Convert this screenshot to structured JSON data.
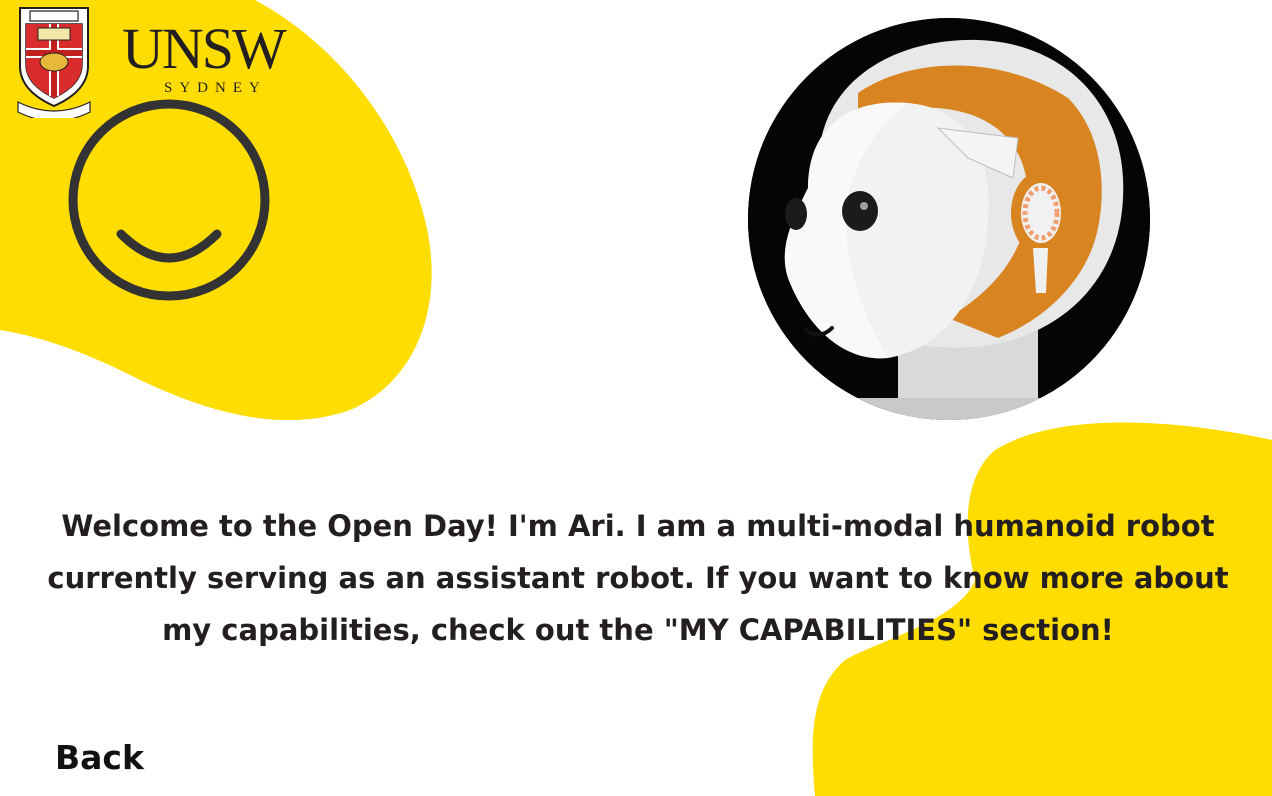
{
  "logo": {
    "wordmark": "UNSW",
    "subtitle": "SYDNEY",
    "crest_motto": "MANU ET MENTE",
    "crest_banner": "SCIENTIA"
  },
  "icons": {
    "smiley": "smiley-face-icon"
  },
  "avatar": {
    "description_name": "robot-head-avatar"
  },
  "message": {
    "text": "Welcome to the Open Day! I'm Ari. I am a multi-modal humanoid robot currently serving as an assistant robot. If you want to know more about my capabilities, check out the \"MY CAPABILITIES\" section!"
  },
  "nav": {
    "back_label": "Back"
  },
  "colors": {
    "accent_yellow": "#ffdd00",
    "text_dark": "#231f20",
    "background": "#ffffff"
  }
}
